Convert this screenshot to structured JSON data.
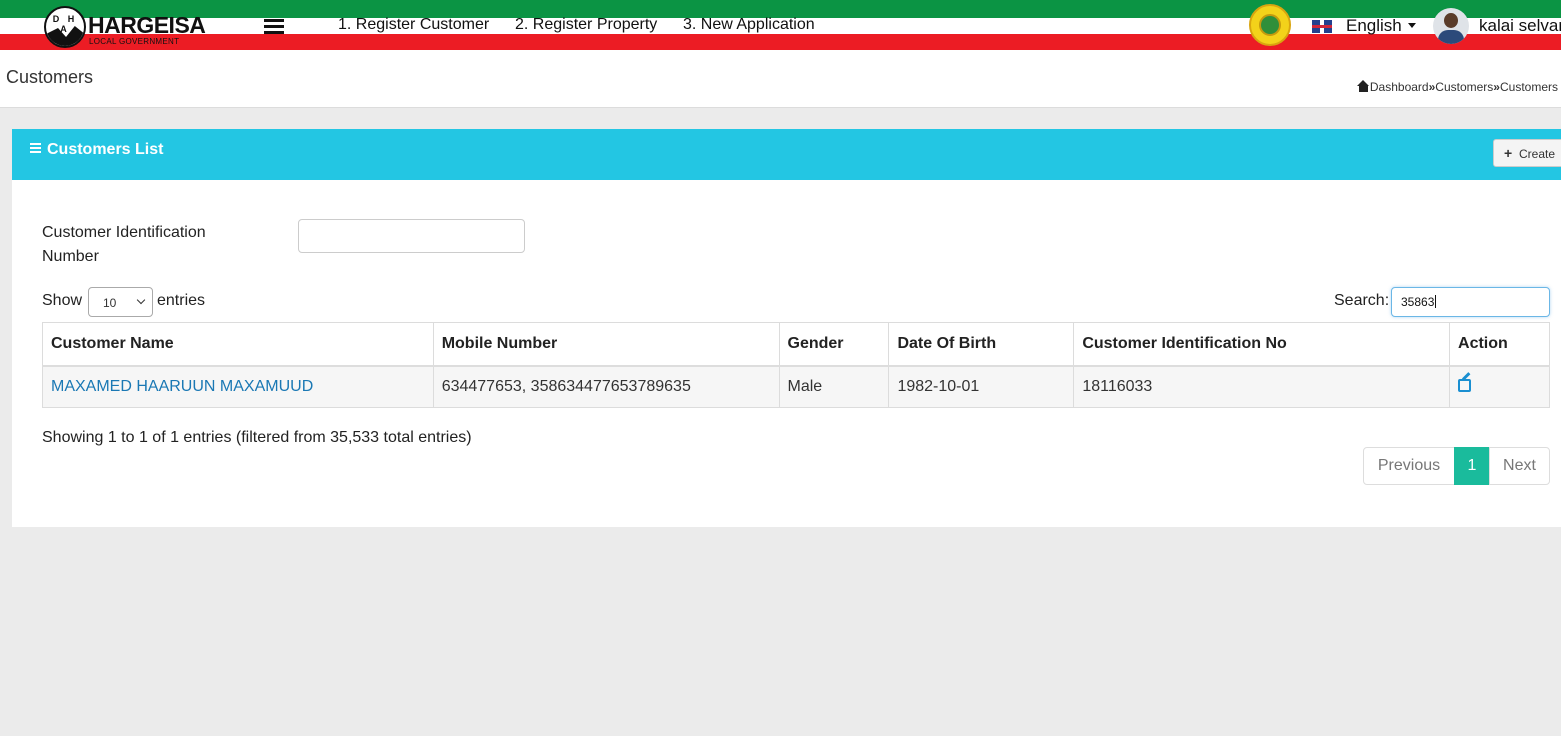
{
  "header": {
    "logo_mark": "D H A",
    "logo_title": "HARGEISA",
    "logo_subtitle": "LOCAL GOVERNMENT",
    "nav": [
      "1. Register Customer",
      "2. Register Property",
      "3. New Application"
    ],
    "language": "English",
    "user": "kalai selvan",
    "colors": {
      "green": "#0b9444",
      "red": "#ec1c24"
    }
  },
  "page": {
    "title": "Customers",
    "breadcrumb": [
      "Dashboard",
      "Customers",
      "Customers"
    ]
  },
  "card": {
    "title": "Customers List",
    "create_label": "Create",
    "header_color": "#23c6e3"
  },
  "filter": {
    "cin_label": "Customer Identification Number",
    "cin_value": ""
  },
  "datatable": {
    "show_label": "Show",
    "page_length": "10",
    "entries_label": "entries",
    "search_label": "Search:",
    "search_value": "35863",
    "columns": [
      "Customer Name",
      "Mobile Number",
      "Gender",
      "Date Of Birth",
      "Customer Identification No",
      "Action"
    ],
    "rows": [
      {
        "name": "MAXAMED HAARUUN MAXAMUUD",
        "mobile": "634477653, 358634477653789635",
        "gender": "Male",
        "dob": "1982-10-01",
        "cin": "18116033",
        "action_icon": "edit-icon"
      }
    ],
    "info": "Showing 1 to 1 of 1 entries (filtered from 35,533 total entries)",
    "pagination": {
      "previous": "Previous",
      "current": "1",
      "next": "Next",
      "active_color": "#1abb9c"
    }
  }
}
